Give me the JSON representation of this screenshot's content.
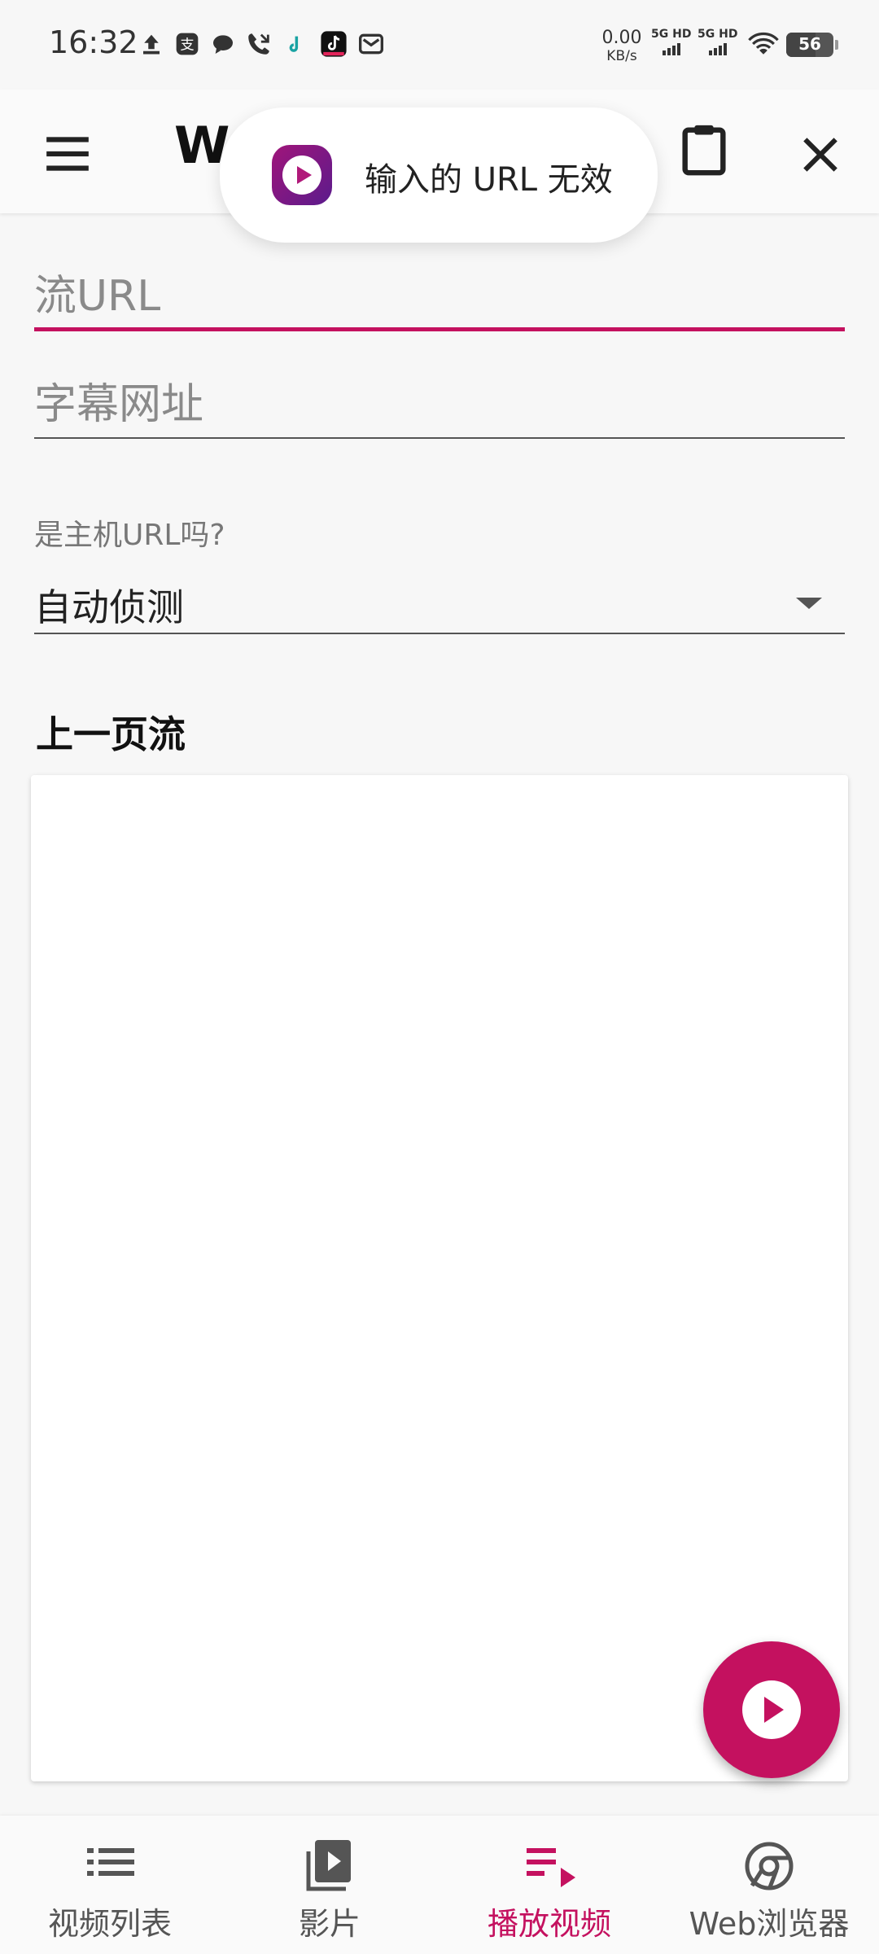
{
  "status_bar": {
    "time": "16:32",
    "net_speed": "0.00",
    "net_speed_unit": "KB/s",
    "sim1": "5G HD",
    "sim2": "5G HD",
    "battery": "56"
  },
  "app_bar": {
    "title": "W",
    "menu_icon": "menu-icon",
    "clipboard_icon": "clipboard-icon",
    "close_icon": "close-icon"
  },
  "toast": {
    "text": "输入的 URL 无效"
  },
  "form": {
    "stream_url_placeholder": "流URL",
    "stream_url_value": "",
    "subtitle_url_placeholder": "字幕网址",
    "subtitle_url_value": "",
    "host_label": "是主机URL吗?",
    "host_selected": "自动侦测"
  },
  "previous_streams": {
    "heading": "上一页流"
  },
  "bottom_nav": {
    "items": [
      {
        "label": "视频列表",
        "icon": "list-icon"
      },
      {
        "label": "影片",
        "icon": "video-library-icon"
      },
      {
        "label": "播放视频",
        "icon": "playlist-play-icon"
      },
      {
        "label": "Web浏览器",
        "icon": "chrome-icon"
      }
    ],
    "active_index": 2
  },
  "colors": {
    "accent": "#c4115f",
    "text_primary": "#222222",
    "text_secondary": "#777777"
  }
}
